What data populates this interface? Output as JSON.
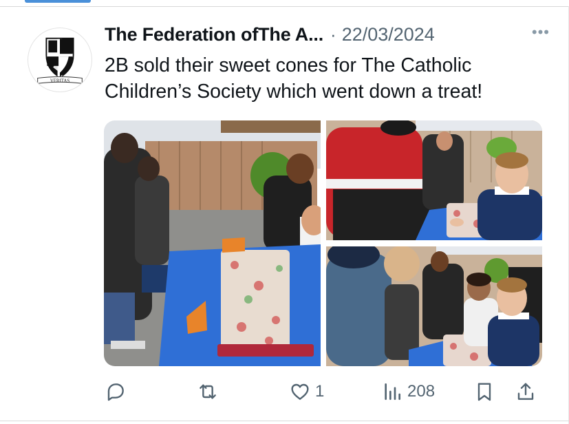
{
  "post": {
    "author_name": "The Federation ofThe A...",
    "separator": "·",
    "date": "22/03/2024",
    "more_label": "•••",
    "text": "2B sold their sweet cones for The Catholic Children’s Society which went down a treat!",
    "avatar": {
      "icon": "dominican-shield-crest",
      "motto": "VERITAS"
    }
  },
  "media": [
    {
      "name": "photo-children-selling-sweets"
    },
    {
      "name": "photo-boy-at-table"
    },
    {
      "name": "photo-children-and-customers"
    }
  ],
  "actions": {
    "reply": {
      "icon": "reply-icon",
      "count": ""
    },
    "repost": {
      "icon": "repost-icon",
      "count": ""
    },
    "like": {
      "icon": "heart-icon",
      "count": "1"
    },
    "views": {
      "icon": "views-icon",
      "count": "208"
    },
    "bookmark": {
      "icon": "bookmark-icon"
    },
    "share": {
      "icon": "share-icon"
    }
  },
  "colors": {
    "icon_gray": "#536471",
    "accent": "#4a90d9",
    "table_blue": "#2f6fd6"
  }
}
